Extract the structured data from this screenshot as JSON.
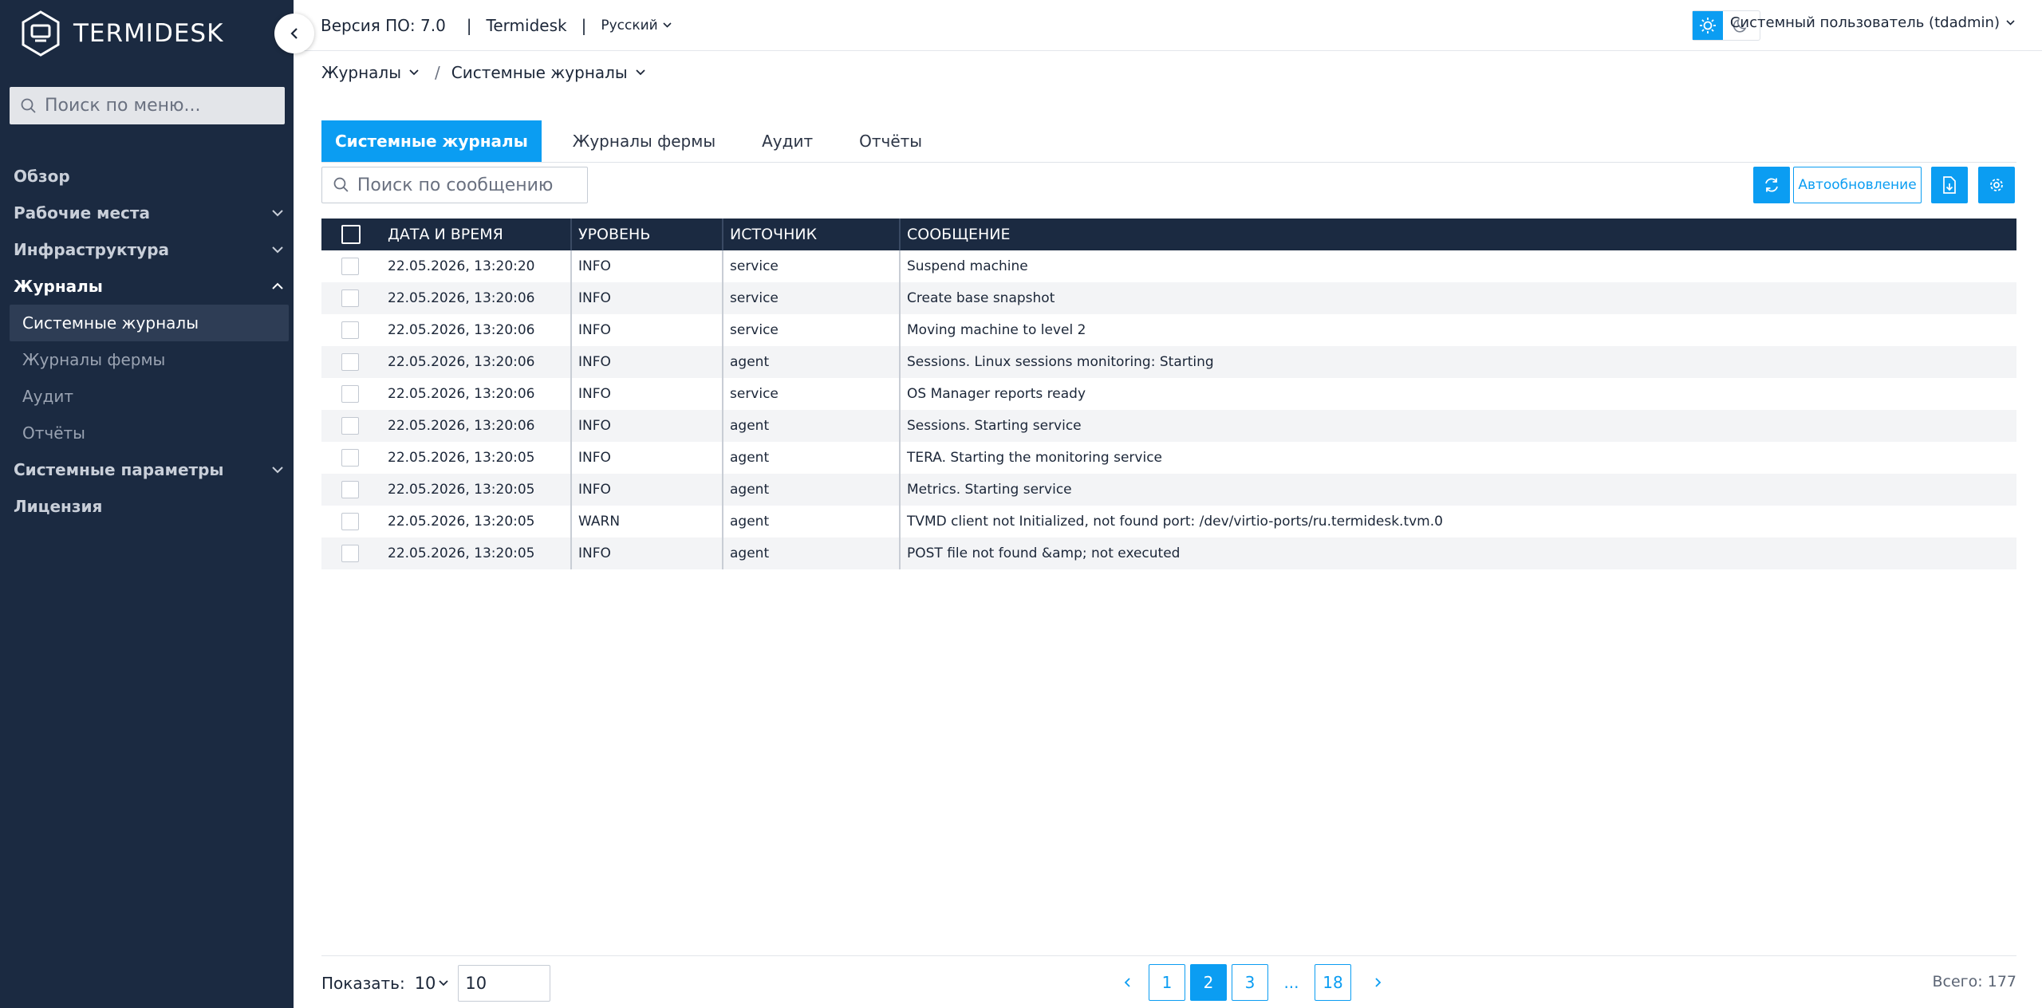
{
  "app": {
    "logo_text": "TERMIDESK",
    "version": "Версия ПО: 7.0",
    "separator": "|",
    "product": "Termidesk",
    "language": "Русский",
    "user": "Системный пользователь (tdadmin)"
  },
  "sidebar": {
    "search_placeholder": "Поиск по меню...",
    "items": [
      {
        "label": "Обзор"
      },
      {
        "label": "Рабочие места"
      },
      {
        "label": "Инфраструктура"
      },
      {
        "label": "Журналы"
      },
      {
        "label": "Системные параметры"
      },
      {
        "label": "Лицензия"
      }
    ],
    "sub_items": [
      {
        "label": "Системные журналы"
      },
      {
        "label": "Журналы фермы"
      },
      {
        "label": "Аудит"
      },
      {
        "label": "Отчёты"
      }
    ]
  },
  "breadcrumb": {
    "root": "Журналы",
    "slash": "/",
    "current": "Системные журналы"
  },
  "tabs": [
    {
      "label": "Системные журналы"
    },
    {
      "label": "Журналы фермы"
    },
    {
      "label": "Аудит"
    },
    {
      "label": "Отчёты"
    }
  ],
  "toolbar": {
    "search_placeholder": "Поиск по сообщению",
    "autorefresh_label": "Автообновление"
  },
  "table": {
    "headers": {
      "date": "ДАТА И ВРЕМЯ",
      "level": "УРОВЕНЬ",
      "source": "ИСТОЧНИК",
      "message": "СООБЩЕНИЕ"
    },
    "rows": [
      {
        "date": "22.05.2026, 13:20:20",
        "level": "INFO",
        "source": "service",
        "message": "Suspend machine"
      },
      {
        "date": "22.05.2026, 13:20:06",
        "level": "INFO",
        "source": "service",
        "message": "Create base snapshot"
      },
      {
        "date": "22.05.2026, 13:20:06",
        "level": "INFO",
        "source": "service",
        "message": "Moving machine to level 2"
      },
      {
        "date": "22.05.2026, 13:20:06",
        "level": "INFO",
        "source": "agent",
        "message": "Sessions. Linux sessions monitoring: Starting"
      },
      {
        "date": "22.05.2026, 13:20:06",
        "level": "INFO",
        "source": "service",
        "message": "OS Manager reports ready"
      },
      {
        "date": "22.05.2026, 13:20:06",
        "level": "INFO",
        "source": "agent",
        "message": "Sessions. Starting service"
      },
      {
        "date": "22.05.2026, 13:20:05",
        "level": "INFO",
        "source": "agent",
        "message": "TERA. Starting the monitoring service"
      },
      {
        "date": "22.05.2026, 13:20:05",
        "level": "INFO",
        "source": "agent",
        "message": "Metrics. Starting service"
      },
      {
        "date": "22.05.2026, 13:20:05",
        "level": "WARN",
        "source": "agent",
        "message": "TVMD client not Initialized, not found port: /dev/virtio-ports/ru.termidesk.tvm.0"
      },
      {
        "date": "22.05.2026, 13:20:05",
        "level": "INFO",
        "source": "agent",
        "message": "POST file not found &amp; not executed"
      }
    ]
  },
  "footer": {
    "show_label": "Показать:",
    "page_size": "10",
    "page_size_input": "10",
    "pages": [
      "1",
      "2",
      "3"
    ],
    "ellipsis": "...",
    "last_page": "18",
    "current_page": "2",
    "total": "Всего: 177"
  },
  "colors": {
    "sidebar_bg": "#1b2a41",
    "accent": "#0b9df2",
    "header_bg": "#1b2a41"
  }
}
